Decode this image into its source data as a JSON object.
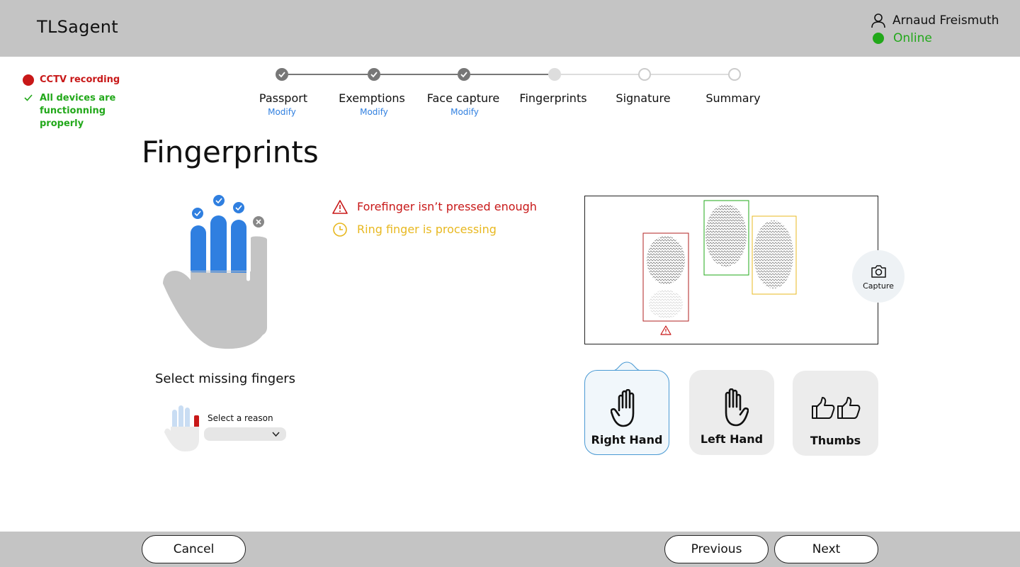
{
  "header": {
    "app_title": "TLSagent",
    "user_name": "Arnaud Freismuth",
    "status": "Online"
  },
  "status_panel": {
    "cctv": "CCTV recording",
    "devices": "All devices are functionning properly"
  },
  "steps": [
    {
      "label": "Passport",
      "modify": "Modify",
      "state": "done"
    },
    {
      "label": "Exemptions",
      "modify": "Modify",
      "state": "done"
    },
    {
      "label": "Face capture",
      "modify": "Modify",
      "state": "done"
    },
    {
      "label": "Fingerprints",
      "state": "current"
    },
    {
      "label": "Signature",
      "state": "todo"
    },
    {
      "label": "Summary",
      "state": "todo"
    }
  ],
  "page_title": "Fingerprints",
  "missing": {
    "title": "Select missing fingers",
    "reason_label": "Select a reason",
    "reason_value": ""
  },
  "messages": {
    "warning": "Forefinger isn’t pressed enough",
    "processing": "Ring finger is processing"
  },
  "capture": {
    "label": "Capture"
  },
  "hand_options": {
    "right": "Right Hand",
    "left": "Left Hand",
    "thumbs": "Thumbs",
    "selected": "right"
  },
  "footer": {
    "cancel": "Cancel",
    "previous": "Previous",
    "next": "Next"
  },
  "colors": {
    "header_bg": "#c4c4c4",
    "error": "#c81818",
    "success": "#22a81a",
    "warning": "#e8b820",
    "accent": "#2f7fe0"
  },
  "icons": {
    "user": "user-icon",
    "check": "check-icon",
    "warning": "warning-triangle-icon",
    "clock": "clock-icon",
    "camera": "camera-icon",
    "chevron": "chevron-down-icon",
    "hand": "hand-icon",
    "thumbs": "thumbs-up-icon"
  }
}
